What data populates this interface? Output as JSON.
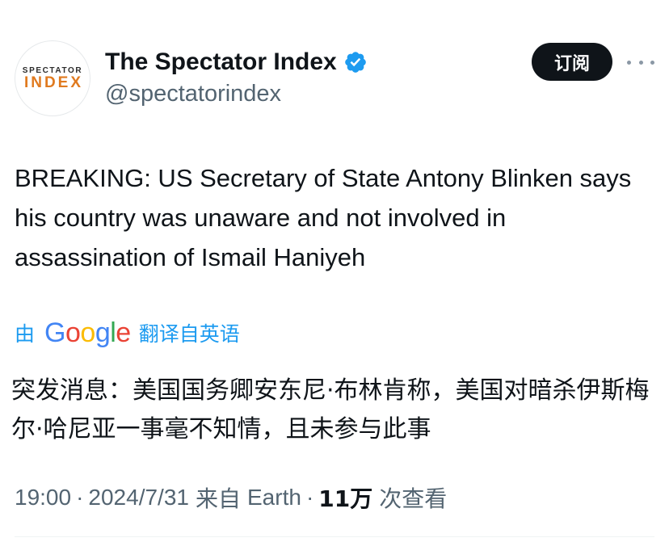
{
  "author": {
    "display_name": "The Spectator Index",
    "handle": "@spectatorindex",
    "verified": true,
    "avatar_logo": {
      "top_text": "SPECTATOR",
      "bottom_text": "INDEX"
    }
  },
  "actions": {
    "subscribe_label": "订阅",
    "more_icon": "more-horizontal-icon"
  },
  "tweet": {
    "text": "BREAKING: US Secretary of State Antony Blinken says his country was unaware and not involved in assassination of Ismail Haniyeh"
  },
  "translation": {
    "by_label": "由",
    "provider": "Google",
    "from_label": "翻译自英语",
    "text": "突发消息：美国国务卿安东尼·布林肯称，美国对暗杀伊斯梅尔·哈尼亚一事毫不知情，且未参与此事"
  },
  "meta": {
    "time": "19:00",
    "separator": "·",
    "date": "2024/7/31",
    "source_prefix": "来自",
    "source": "Earth",
    "views_count": "11万",
    "views_label": "次查看"
  },
  "colors": {
    "link_blue": "#1d9bf0",
    "verified_blue": "#1d9bf0",
    "secondary_text": "#536471",
    "primary_text": "#0f1419",
    "logo_orange": "#e07a1f"
  }
}
